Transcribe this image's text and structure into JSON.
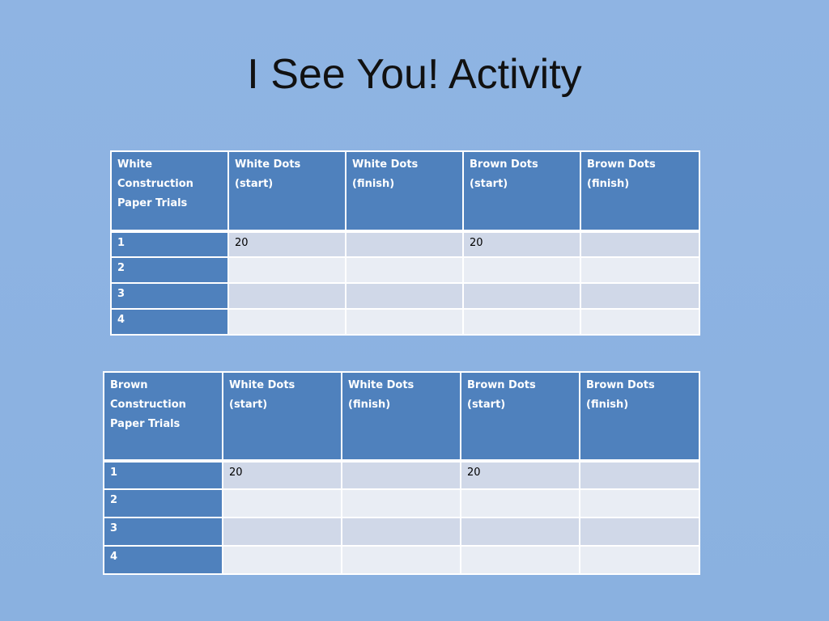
{
  "slide": {
    "title": "I See You! Activity",
    "colors": {
      "background": "#8db3e2",
      "header_fill": "#4f81bd",
      "row_odd_fill": "#d0d8e8",
      "row_even_fill": "#e9edf4"
    }
  },
  "tables": [
    {
      "headers": [
        "White Construction Paper Trials",
        "White Dots (start)",
        "White Dots (finish)",
        "Brown Dots (start)",
        "Brown Dots (finish)"
      ],
      "rows": [
        {
          "trial": "1",
          "cells": [
            "20",
            "",
            "20",
            ""
          ]
        },
        {
          "trial": "2",
          "cells": [
            "",
            "",
            "",
            ""
          ]
        },
        {
          "trial": "3",
          "cells": [
            "",
            "",
            "",
            ""
          ]
        },
        {
          "trial": "4",
          "cells": [
            "",
            "",
            "",
            ""
          ]
        }
      ]
    },
    {
      "headers": [
        "Brown Construction Paper Trials",
        "White Dots (start)",
        "White Dots (finish)",
        "Brown Dots (start)",
        "Brown Dots (finish)"
      ],
      "rows": [
        {
          "trial": "1",
          "cells": [
            "20",
            "",
            "20",
            ""
          ]
        },
        {
          "trial": "2",
          "cells": [
            "",
            "",
            "",
            ""
          ]
        },
        {
          "trial": "3",
          "cells": [
            "",
            "",
            "",
            ""
          ]
        },
        {
          "trial": "4",
          "cells": [
            "",
            "",
            "",
            ""
          ]
        }
      ]
    }
  ]
}
